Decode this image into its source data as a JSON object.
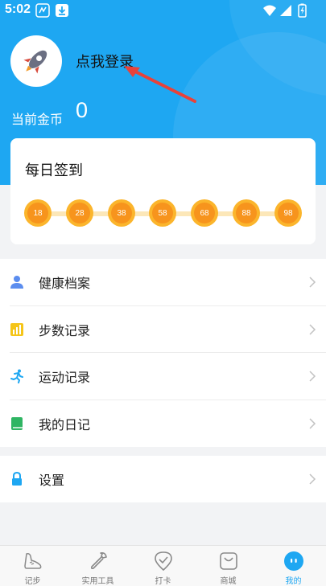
{
  "status_bar": {
    "time": "5:02"
  },
  "profile": {
    "login_text": "点我登录",
    "coin_label": "当前金币",
    "coin_value": "0"
  },
  "signin": {
    "title": "每日签到",
    "rewards": [
      "18",
      "28",
      "38",
      "58",
      "68",
      "88",
      "98"
    ]
  },
  "menu": {
    "items": [
      {
        "label": "健康档案",
        "icon": "health-profile-icon"
      },
      {
        "label": "步数记录",
        "icon": "step-record-icon"
      },
      {
        "label": "运动记录",
        "icon": "exercise-record-icon"
      },
      {
        "label": "我的日记",
        "icon": "diary-icon"
      }
    ],
    "settings": {
      "label": "设置",
      "icon": "lock-icon"
    }
  },
  "tabbar": {
    "tabs": [
      {
        "label": "记步",
        "icon": "shoe-icon"
      },
      {
        "label": "实用工具",
        "icon": "wrench-icon"
      },
      {
        "label": "打卡",
        "icon": "checkin-icon"
      },
      {
        "label": "商城",
        "icon": "shopping-bag-icon"
      },
      {
        "label": "我的",
        "icon": "profile-icon",
        "active": true
      }
    ]
  },
  "colors": {
    "accent": "#1ea7f2",
    "coin": "#f7941d",
    "coin_track": "#fce7b8"
  }
}
